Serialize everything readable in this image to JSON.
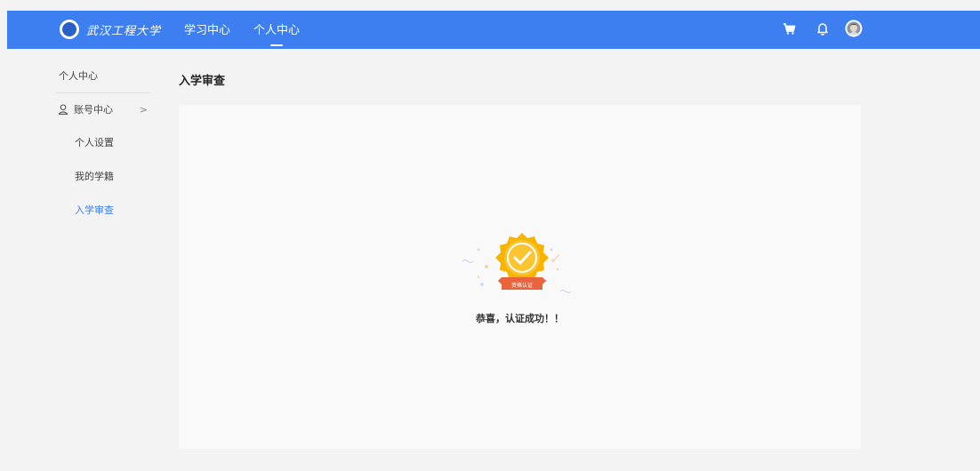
{
  "header": {
    "logo_text": "武汉工程大学",
    "tabs": [
      {
        "label": "学习中心"
      },
      {
        "label": "个人中心"
      }
    ]
  },
  "sidebar": {
    "title": "个人中心",
    "group": {
      "label": "账号中心",
      "chevron": ">"
    },
    "items": [
      {
        "label": "个人设置"
      },
      {
        "label": "我的学籍"
      },
      {
        "label": "入学审查"
      }
    ]
  },
  "main": {
    "title": "入学审查",
    "badge_ribbon": "资格认证",
    "success_message": "恭喜，认证成功！！"
  },
  "icons": [
    "cart-icon",
    "bell-icon",
    "avatar"
  ],
  "colors": {
    "brand": "#3d7ff0",
    "badge_gold": "#f9b400",
    "ribbon": "#e8643c"
  }
}
